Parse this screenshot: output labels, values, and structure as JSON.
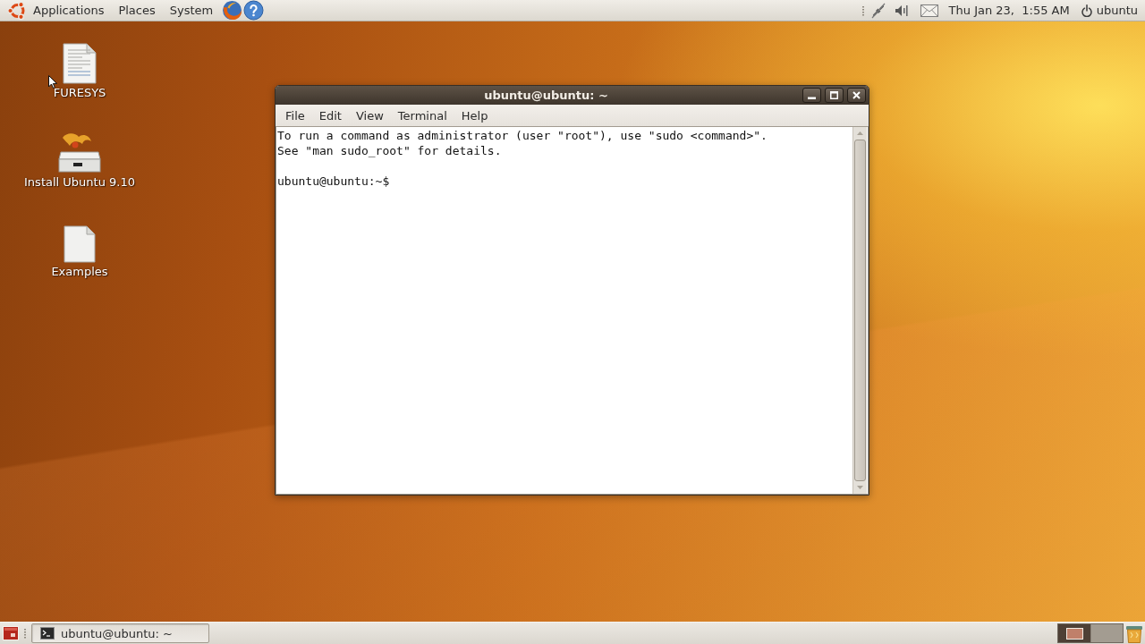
{
  "top_panel": {
    "menus": [
      {
        "label": "Applications"
      },
      {
        "label": "Places"
      },
      {
        "label": "System"
      }
    ],
    "clock": "Thu Jan 23,  1:55 AM",
    "user": "ubuntu"
  },
  "desktop_icons": [
    {
      "label": "FURESYS",
      "kind": "document"
    },
    {
      "label": "Install Ubuntu 9.10",
      "kind": "installer"
    },
    {
      "label": "Examples",
      "kind": "blank"
    }
  ],
  "terminal_window": {
    "title": "ubuntu@ubuntu: ~",
    "menu": [
      {
        "label": "File"
      },
      {
        "label": "Edit"
      },
      {
        "label": "View"
      },
      {
        "label": "Terminal"
      },
      {
        "label": "Help"
      }
    ],
    "output": [
      "To run a command as administrator (user \"root\"), use \"sudo <command>\".",
      "See \"man sudo_root\" for details."
    ],
    "prompt": "ubuntu@ubuntu:~$"
  },
  "taskbar": {
    "windows": [
      {
        "label": "ubuntu@ubuntu: ~",
        "selected": true
      }
    ]
  },
  "workspaces": [
    {
      "selected": true,
      "has_window": true
    },
    {
      "selected": false,
      "has_window": false
    }
  ]
}
